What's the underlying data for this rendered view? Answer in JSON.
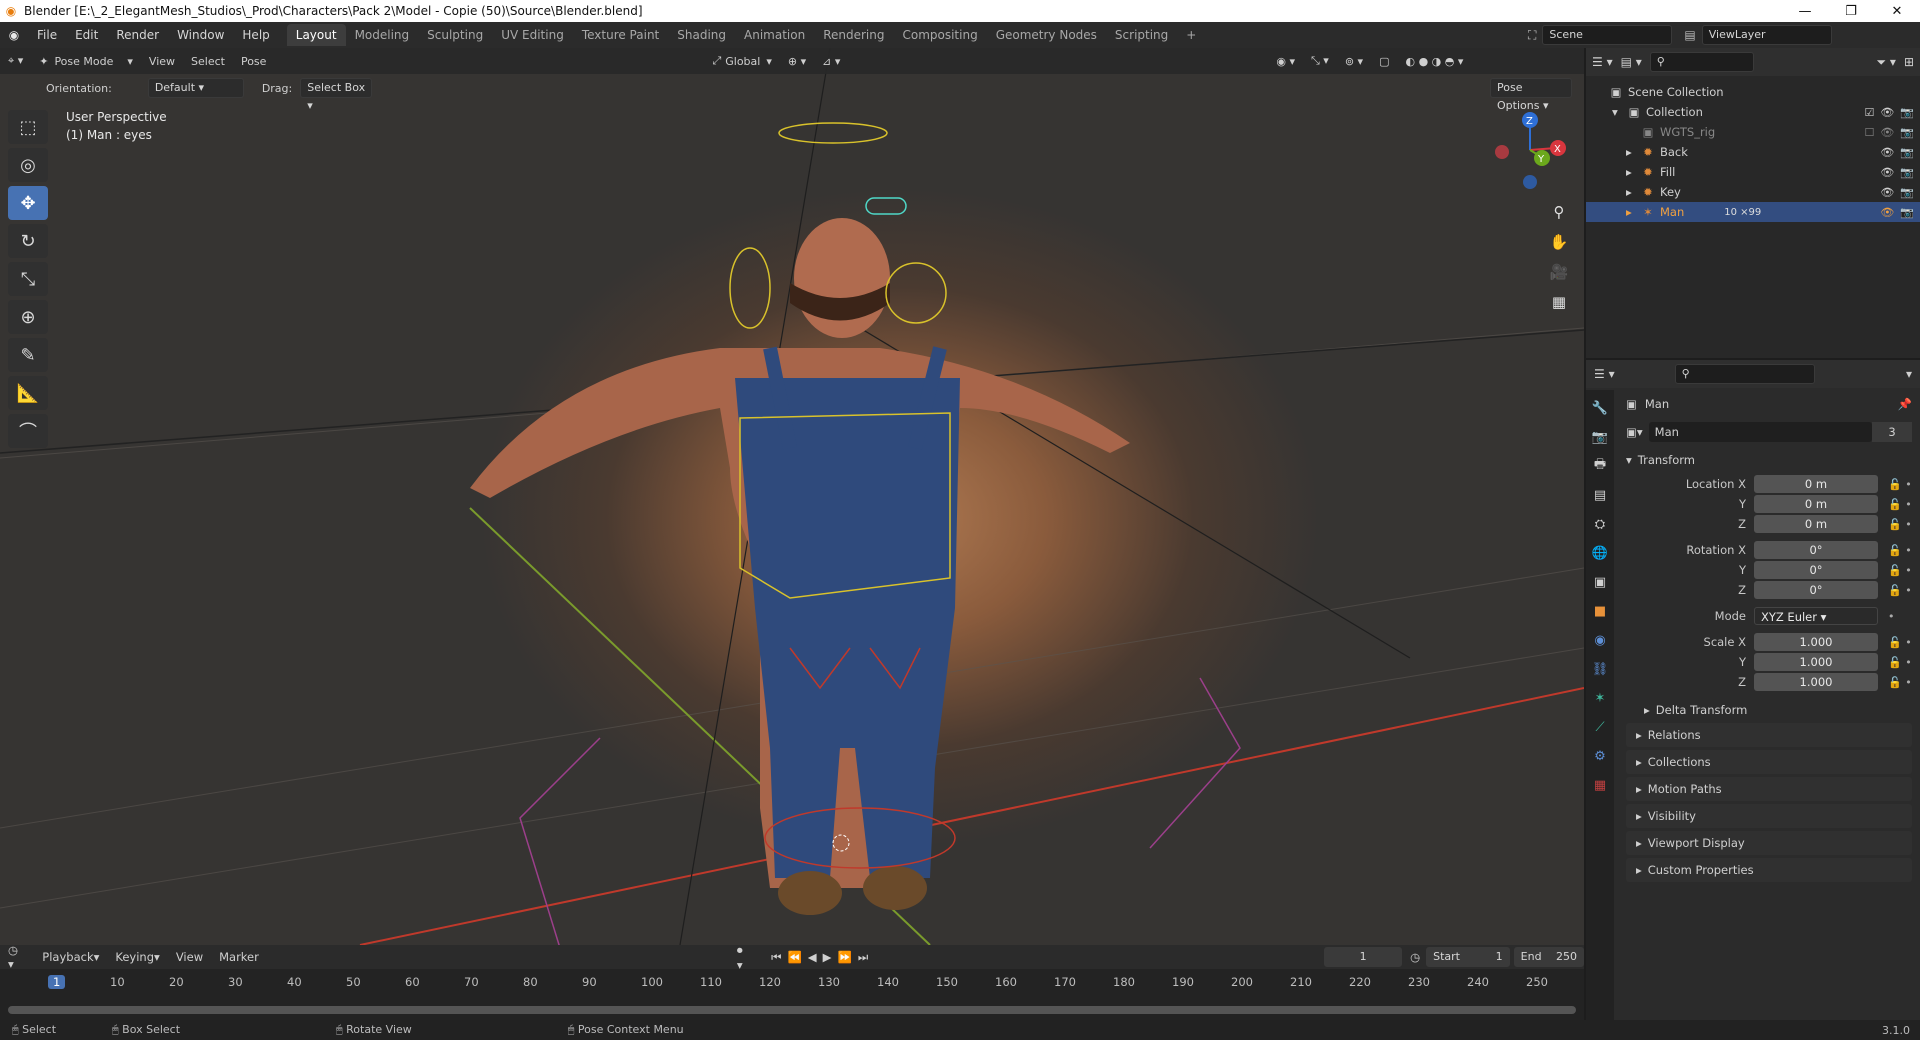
{
  "window": {
    "title": "Blender [E:\\_2_ElegantMesh_Studios\\_Prod\\Characters\\Pack 2\\Model - Copie (50)\\Source\\Blender.blend]",
    "controls": [
      "—",
      "❐",
      "✕"
    ]
  },
  "menu": [
    "File",
    "Edit",
    "Render",
    "Window",
    "Help"
  ],
  "workspaces": [
    "Layout",
    "Modeling",
    "Sculpting",
    "UV Editing",
    "Texture Paint",
    "Shading",
    "Animation",
    "Rendering",
    "Compositing",
    "Geometry Nodes",
    "Scripting",
    "+"
  ],
  "active_workspace": "Layout",
  "scene": {
    "scene_name": "Scene",
    "view_layer": "ViewLayer"
  },
  "viewport_header": {
    "mode": "Pose Mode",
    "menus": [
      "View",
      "Select",
      "Pose"
    ],
    "orientation_transform": "Global",
    "orientation_label": "Orientation:",
    "orientation_value": "Default",
    "drag_label": "Drag:",
    "drag_value": "Select Box",
    "pose_options": "Pose Options"
  },
  "viewport_info": {
    "line1": "User Perspective",
    "line2": "(1) Man : eyes"
  },
  "gizmo": {
    "x": "X",
    "y": "Y",
    "z": "Z"
  },
  "outliner": {
    "root": "Scene Collection",
    "rows": [
      {
        "name": "Collection",
        "indent": 1
      },
      {
        "name": "WGTS_rig",
        "indent": 2
      },
      {
        "name": "Back",
        "indent": 2
      },
      {
        "name": "Fill",
        "indent": 2
      },
      {
        "name": "Key",
        "indent": 2
      },
      {
        "name": "Man",
        "indent": 2,
        "extra": "10 ×99"
      }
    ]
  },
  "properties": {
    "object_name": "Man",
    "datablock_name": "Man",
    "datablock_users": "3",
    "transform_title": "Transform",
    "location": [
      {
        "label": "Location X",
        "value": "0 m"
      },
      {
        "label": "Y",
        "value": "0 m"
      },
      {
        "label": "Z",
        "value": "0 m"
      }
    ],
    "rotation": [
      {
        "label": "Rotation X",
        "value": "0°"
      },
      {
        "label": "Y",
        "value": "0°"
      },
      {
        "label": "Z",
        "value": "0°"
      }
    ],
    "mode_label": "Mode",
    "mode_value": "XYZ Euler",
    "scale": [
      {
        "label": "Scale X",
        "value": "1.000"
      },
      {
        "label": "Y",
        "value": "1.000"
      },
      {
        "label": "Z",
        "value": "1.000"
      }
    ],
    "delta": "Delta Transform",
    "panels": [
      "Relations",
      "Collections",
      "Motion Paths",
      "Visibility",
      "Viewport Display",
      "Custom Properties"
    ]
  },
  "timeline": {
    "menus": [
      "Playback",
      "Keying",
      "View",
      "Marker"
    ],
    "current_frame": "1",
    "start_label": "Start",
    "start": "1",
    "end_label": "End",
    "end": "250",
    "ruler": [
      "1",
      "10",
      "20",
      "30",
      "40",
      "50",
      "60",
      "70",
      "80",
      "90",
      "100",
      "110",
      "120",
      "130",
      "140",
      "150",
      "160",
      "170",
      "180",
      "190",
      "200",
      "210",
      "220",
      "230",
      "240",
      "250"
    ]
  },
  "statusbar": {
    "items": [
      "Select",
      "Box Select",
      "Rotate View",
      "Pose Context Menu"
    ],
    "version": "3.1.0"
  }
}
